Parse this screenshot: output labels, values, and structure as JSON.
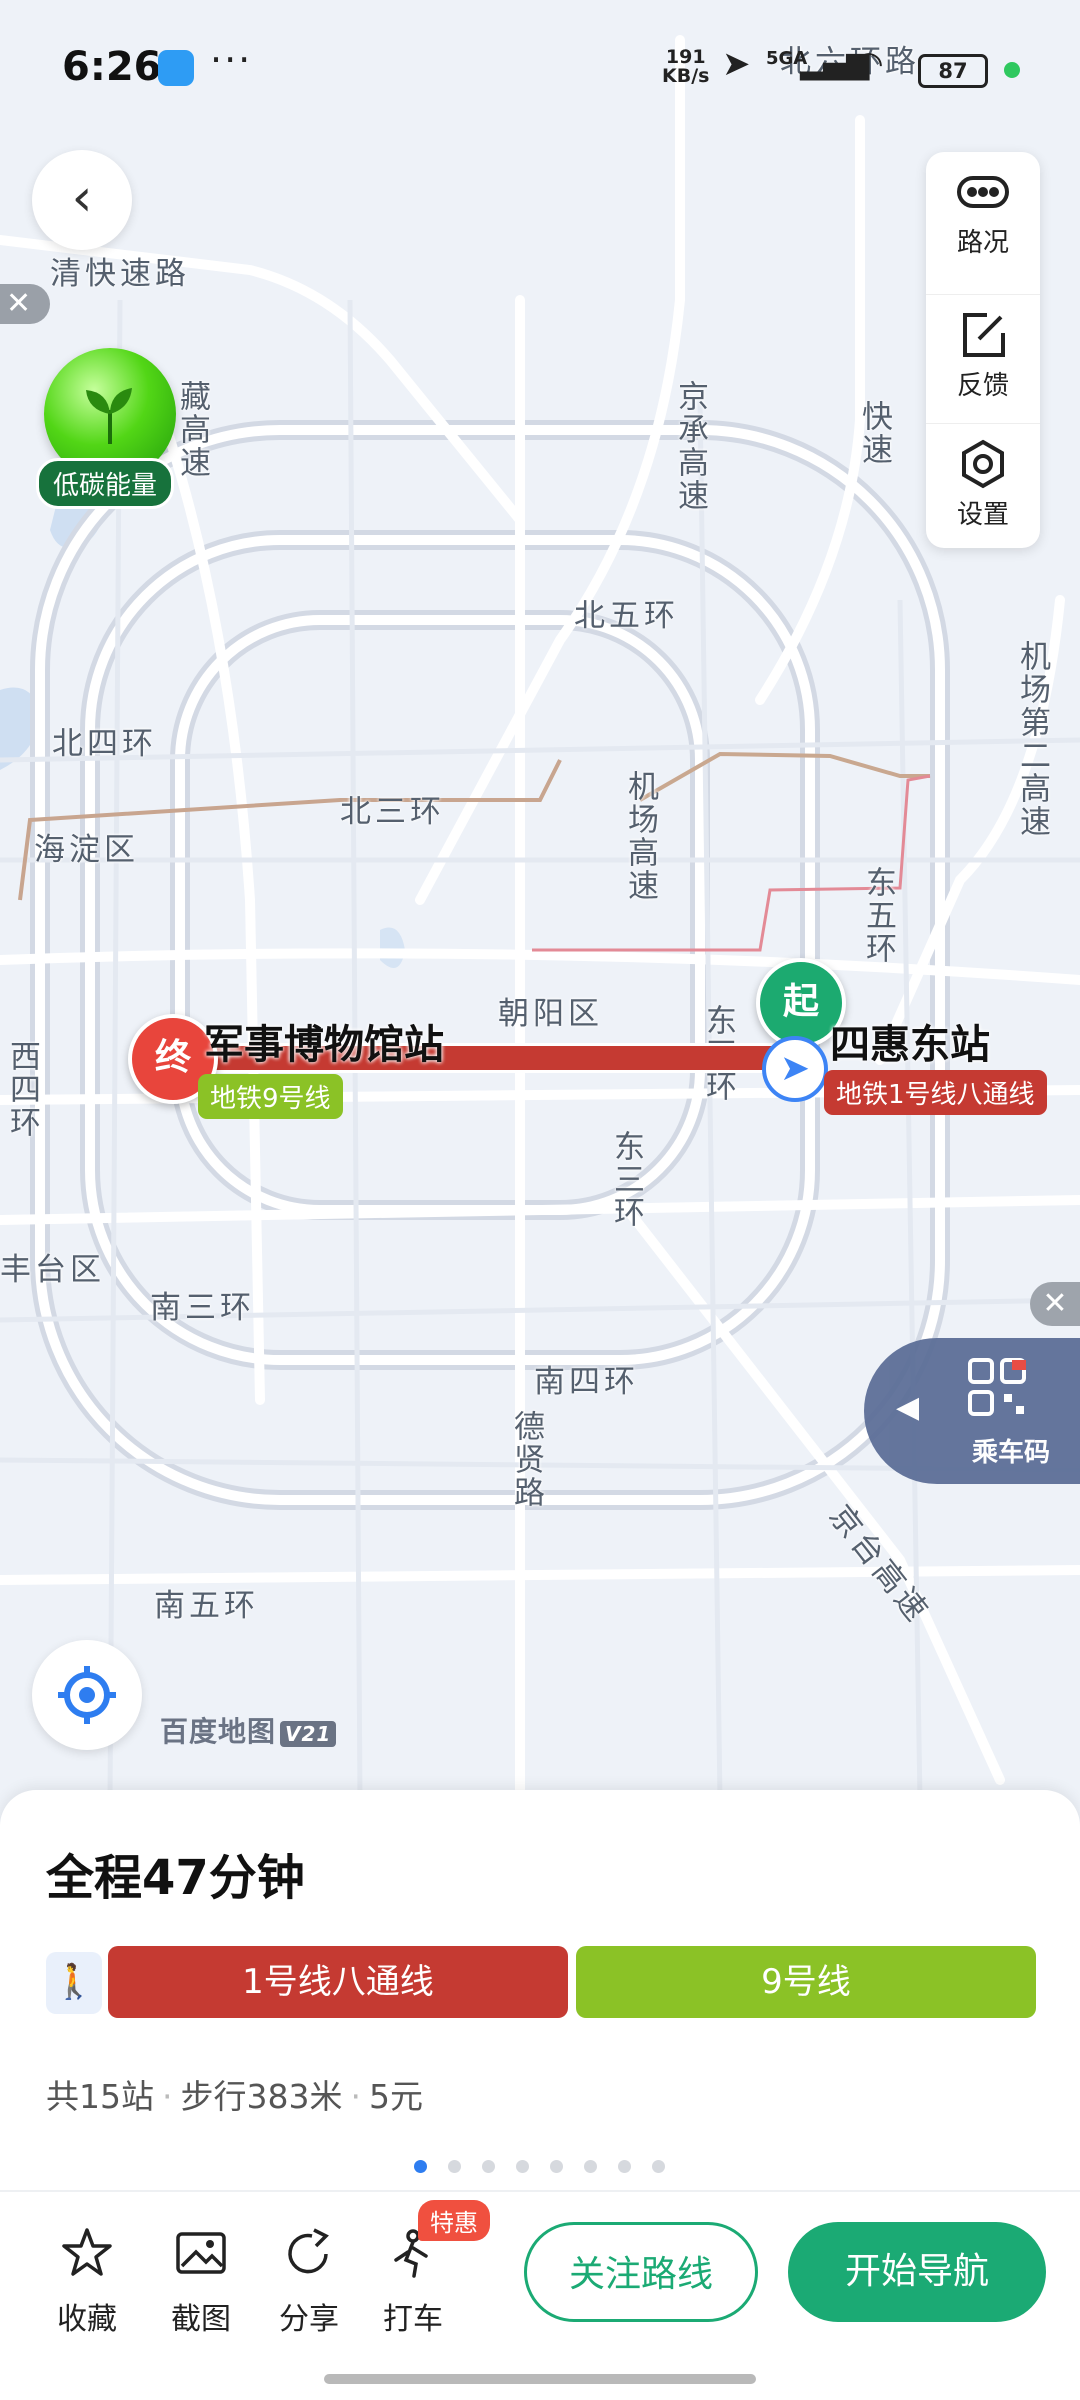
{
  "status": {
    "time": "6:26",
    "more": "···",
    "net_speed_top": "191",
    "net_speed_bottom": "KB/s",
    "signal": "5GA",
    "battery": "87"
  },
  "map": {
    "labels": {
      "qingkuai": "清快速路",
      "beiliuhuan": "北六环路",
      "cang_highway": "藏高速",
      "jingcheng": "京承高速",
      "kuai": "快速",
      "beiwuhuan": "北五环",
      "airport2": "机场第二高速",
      "beisihuan": "北四环",
      "beisanhuan": "北三环",
      "haidian": "海淀区",
      "airport_exp": "机场高速",
      "dongwuhuan": "东五环",
      "chaoyang": "朝阳区",
      "xisihuan": "西四环",
      "dongsihuan": "东四环",
      "dongsanhuan": "东三环",
      "fengtai": "丰台区",
      "nansanhuan": "南三环",
      "nansihuan": "南四环",
      "dexian": "德贤路",
      "jingtai": "京台高速",
      "nanwuhuan": "南五环"
    },
    "low_carbon": "低碳能量",
    "brand": "百度地图",
    "brand_version": "V21"
  },
  "toolbar": {
    "traffic": "路况",
    "feedback": "反馈",
    "settings": "设置"
  },
  "route_map": {
    "end_pin": "终",
    "start_pin": "起",
    "end_station": "军事博物馆站",
    "end_line": "地铁9号线",
    "start_station": "四惠东站",
    "start_line": "地铁1号线八通线"
  },
  "ride_code": {
    "label": "乘车码",
    "close": "✕"
  },
  "sheet": {
    "total": "全程47分钟",
    "segments": [
      "1号线八通线",
      "9号线"
    ],
    "segment_colors": [
      "#c53a32",
      "#8bc226"
    ],
    "summary": {
      "stations": "共15站",
      "walk": "步行383米",
      "price": "5元",
      "sep": "·"
    },
    "page_count": 8,
    "page_active": 0
  },
  "actions": {
    "favorite": "收藏",
    "screenshot": "截图",
    "share": "分享",
    "taxi": "打车",
    "promo": "特惠",
    "follow": "关注路线",
    "navigate": "开始导航"
  }
}
